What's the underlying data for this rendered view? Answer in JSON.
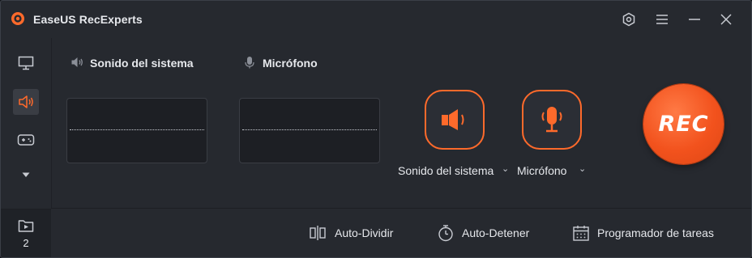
{
  "app": {
    "title": "EaseUS RecExperts"
  },
  "sources": {
    "system_sound": {
      "label": "Sonido del sistema"
    },
    "microphone": {
      "label": "Micrófono"
    }
  },
  "devices": {
    "system_sound_label": "Sonido del sistema",
    "microphone_label": "Micrófono",
    "chevron": "⌄"
  },
  "record": {
    "label": "REC"
  },
  "sidebar": {
    "recordings_count": "2"
  },
  "bottom_bar": {
    "auto_split": "Auto-Dividir",
    "auto_stop": "Auto-Detener",
    "scheduler": "Programador de tareas"
  },
  "colors": {
    "accent": "#ff6a2b",
    "background": "#26292f"
  }
}
